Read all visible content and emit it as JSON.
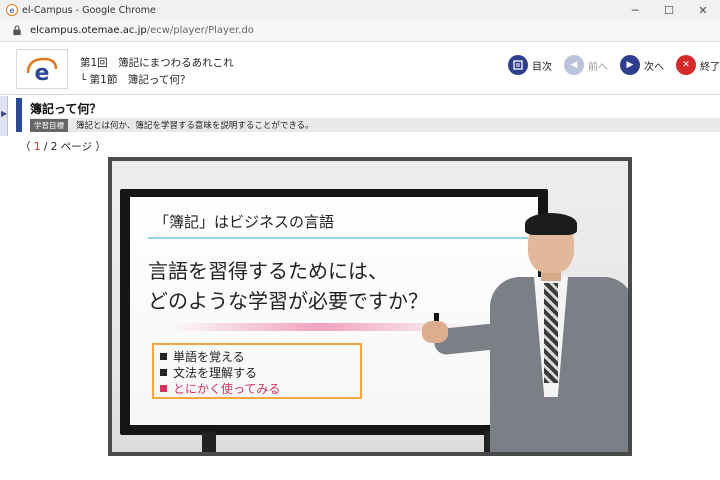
{
  "browser": {
    "window_title": "el-Campus - Google Chrome",
    "controls": {
      "minimize": "─",
      "maximize": "☐",
      "close": "✕"
    },
    "address": {
      "host": "elcampus.otemae.ac.jp",
      "path": "/ecw/player/Player.do"
    }
  },
  "header": {
    "logo_letter": "e",
    "course_line1": "第1回　簿記にまつわるあれこれ",
    "course_line2": "└ 第1節　簿記って何？",
    "nav": {
      "toc_label": "目次",
      "prev_label": "前へ",
      "next_label": "次へ",
      "end_label": "終了"
    }
  },
  "section": {
    "side_tab": "▶",
    "title": "簿記って何？",
    "goal_badge": "学習目標",
    "goal_text": "簿記とは何か、簿記を学習する意味を説明することができる。"
  },
  "pagination": {
    "open": "（ ",
    "current": "1",
    "sep": " / ",
    "total": "2",
    "suffix": " ページ ）"
  },
  "video": {
    "slide_title": "「簿記」はビジネスの言語",
    "question_line1": "言語を習得するためには、",
    "question_line2": "どのような学習が必要ですか？",
    "items": [
      "単語を覚える",
      "文法を理解する",
      "とにかく使ってみる"
    ]
  },
  "colors": {
    "accent_blue": "#2c4a93",
    "nav_blue": "#2f3d8f",
    "nav_red": "#d42a2a",
    "highlight_pink": "#d6335f",
    "box_orange": "#f0a54a"
  },
  "icons": {
    "favicon": "el-campus-logo-icon",
    "lock": "lock-icon",
    "toc": "toc-icon",
    "prev": "arrow-left-icon",
    "next": "arrow-right-icon",
    "end": "close-icon"
  }
}
